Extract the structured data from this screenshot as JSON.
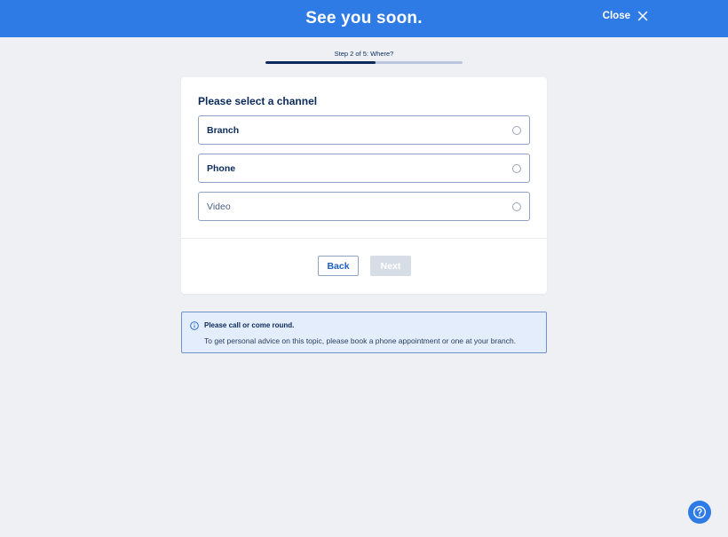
{
  "header": {
    "title": "See you soon.",
    "close_label": "Close",
    "close_icon": "close-icon"
  },
  "progress": {
    "step_label": "Step 2 of 5: Where?",
    "current_step": 2,
    "total_steps": 5,
    "fill_fraction": 0.56
  },
  "card": {
    "heading": "Please select a channel",
    "options": [
      {
        "label": "Branch",
        "selected": false
      },
      {
        "label": "Phone",
        "selected": false
      },
      {
        "label": "Video",
        "selected": false
      }
    ],
    "back_label": "Back",
    "next_label": "Next"
  },
  "info": {
    "icon": "info-icon",
    "title": "Please call or come round.",
    "text": "To get personal advice on this topic, please book a phone appointment or one at your branch."
  },
  "help": {
    "icon": "help-icon"
  },
  "colors": {
    "brand": "#2f7be5",
    "navy": "#0b2a5b",
    "background": "#eef0f4",
    "info_bg": "#e3edfb"
  }
}
